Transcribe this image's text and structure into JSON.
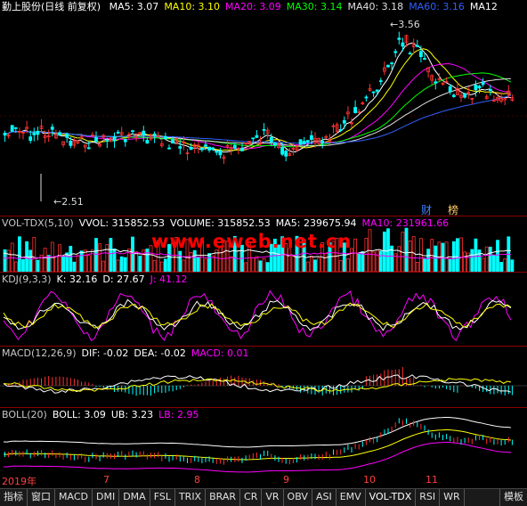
{
  "main": {
    "title": "勤上股份(日线 前复权)",
    "ma": [
      {
        "label": "MA5: 3.07",
        "color": "#ffffff"
      },
      {
        "label": "MA10: 3.10",
        "color": "#ffff00"
      },
      {
        "label": "MA20: 3.09",
        "color": "#ff00ff"
      },
      {
        "label": "MA30: 3.14",
        "color": "#00ff00"
      },
      {
        "label": "MA40: 3.18",
        "color": "#e0e0e0"
      },
      {
        "label": "MA60: 3.16",
        "color": "#3060ff"
      },
      {
        "label": "MA12",
        "color": "#ffffff"
      }
    ],
    "high_label": "3.56",
    "low_label": "2.51",
    "cai": "财",
    "bang": "榜"
  },
  "watermark": "www.eweb.net.cn",
  "vol": {
    "items": [
      {
        "label": "VOL-TDX(5,10)",
        "color": "#c8c8c8"
      },
      {
        "label": "VVOL: 315852.53",
        "color": "#ffffff"
      },
      {
        "label": "VOLUME: 315852.53",
        "color": "#ffffff"
      },
      {
        "label": "MA5: 239675.94",
        "color": "#ffffff"
      },
      {
        "label": "MA10: 231961.66",
        "color": "#ff00ff"
      }
    ]
  },
  "kdj": {
    "items": [
      {
        "label": "KDJ(9,3,3)",
        "color": "#c8c8c8"
      },
      {
        "label": "K: 32.16",
        "color": "#ffffff"
      },
      {
        "label": "D: 27.67",
        "color": "#ffffff"
      },
      {
        "label": "J: 41.12",
        "color": "#ff00ff"
      }
    ]
  },
  "macd": {
    "items": [
      {
        "label": "MACD(12,26,9)",
        "color": "#c8c8c8"
      },
      {
        "label": "DIF: -0.02",
        "color": "#ffffff"
      },
      {
        "label": "DEA: -0.02",
        "color": "#ffffff"
      },
      {
        "label": "MACD: 0.01",
        "color": "#ff00ff"
      }
    ]
  },
  "boll": {
    "items": [
      {
        "label": "BOLL(20)",
        "color": "#c8c8c8"
      },
      {
        "label": "BOLL: 3.09",
        "color": "#ffffff"
      },
      {
        "label": "UB: 3.23",
        "color": "#ffffff"
      },
      {
        "label": "LB: 2.95",
        "color": "#ff00ff"
      }
    ]
  },
  "dates": [
    "2019年",
    "7",
    "8",
    "9",
    "10",
    "11"
  ],
  "tabs": [
    "指标",
    "窗口",
    "MACD",
    "DMI",
    "DMA",
    "FSL",
    "TRIX",
    "BRAR",
    "CR",
    "VR",
    "OBV",
    "ASI",
    "EMV",
    "VOL-TDX",
    "RSI",
    "WR"
  ],
  "mb_label": "模板"
}
